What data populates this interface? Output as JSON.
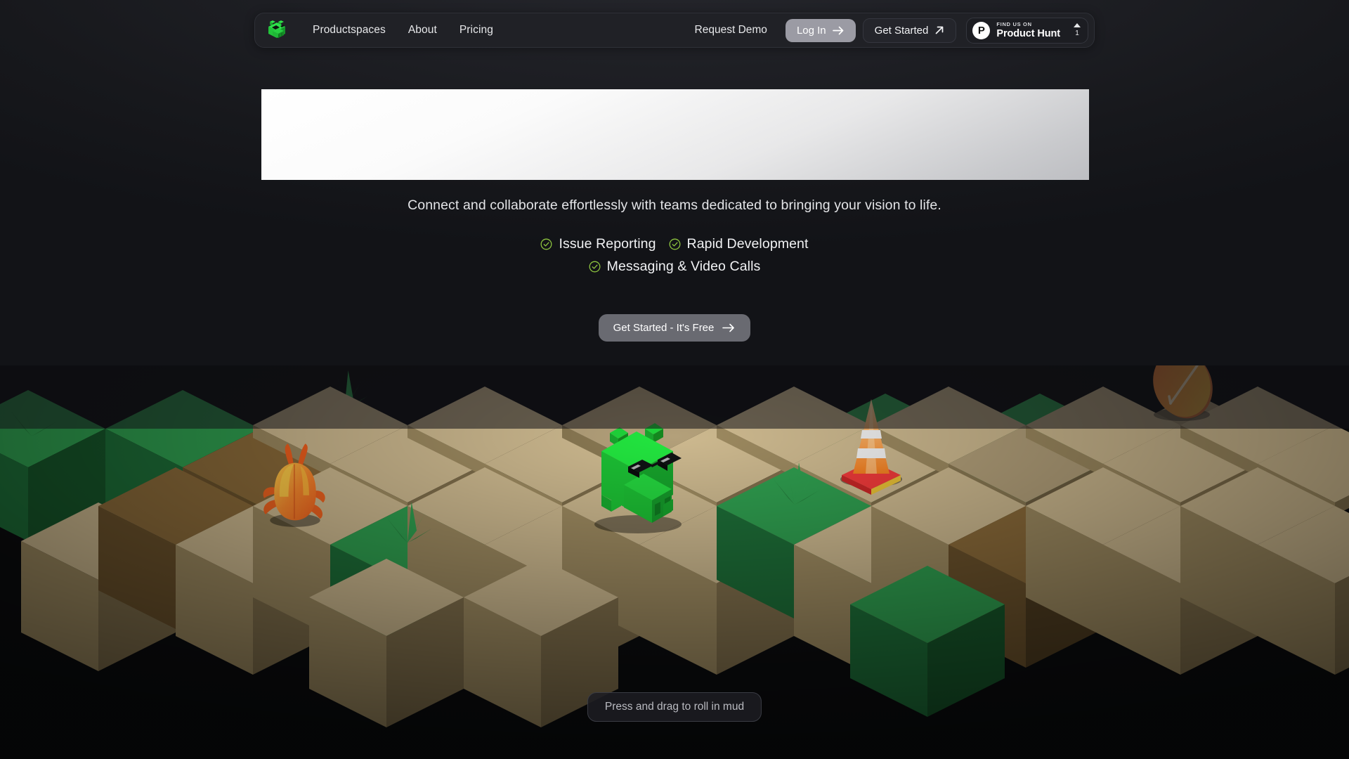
{
  "brand": {
    "logo_icon": "pig-logo-icon",
    "name": "Productspaces"
  },
  "nav": {
    "links": [
      {
        "label": "Productspaces",
        "name": "nav-link-productspaces"
      },
      {
        "label": "About",
        "name": "nav-link-about"
      },
      {
        "label": "Pricing",
        "name": "nav-link-pricing"
      }
    ],
    "request_demo": "Request Demo",
    "login": {
      "label": "Log In",
      "icon": "arrow-right-icon"
    },
    "get_started": {
      "label": "Get Started",
      "icon": "arrow-up-right-icon"
    },
    "product_hunt": {
      "kicker": "FIND US ON",
      "name": "Product Hunt",
      "logo_letter": "P",
      "upvote_icon": "triangle-up-icon",
      "upvote_count": "1"
    }
  },
  "hero": {
    "title_placeholder": "",
    "subtitle": "Connect and collaborate effortlessly with teams dedicated to bringing your vision to life.",
    "features": [
      {
        "label": "Issue Reporting",
        "icon": "check-circle-icon"
      },
      {
        "label": "Rapid Development",
        "icon": "check-circle-icon"
      },
      {
        "label": "Messaging & Video Calls",
        "icon": "check-circle-icon"
      }
    ],
    "cta": {
      "label": "Get Started - It's Free",
      "icon": "arrow-right-icon"
    }
  },
  "scene": {
    "hint": "Press and drag to roll in mud",
    "characters": [
      {
        "name": "green-pig-character",
        "label": "green voxel pig with sunglasses"
      },
      {
        "name": "orange-beetle-character",
        "label": "orange beetle"
      },
      {
        "name": "traffic-cone-prop",
        "label": "traffic cone"
      },
      {
        "name": "orange-coin-prop",
        "label": "orange coin disc"
      }
    ]
  },
  "colors": {
    "background": "#121317",
    "nav_bg": "#202126",
    "accent_green": "#22c33a",
    "check_green": "#8ec63f",
    "login_bg": "#9b9ba4",
    "sand_top": "#cdb98f",
    "sand_side": "#8b7751",
    "grass_top": "#2f9e4f",
    "grass_side": "#1c6b36",
    "mud_top": "#8a6a39",
    "mud_side": "#5c462a"
  }
}
